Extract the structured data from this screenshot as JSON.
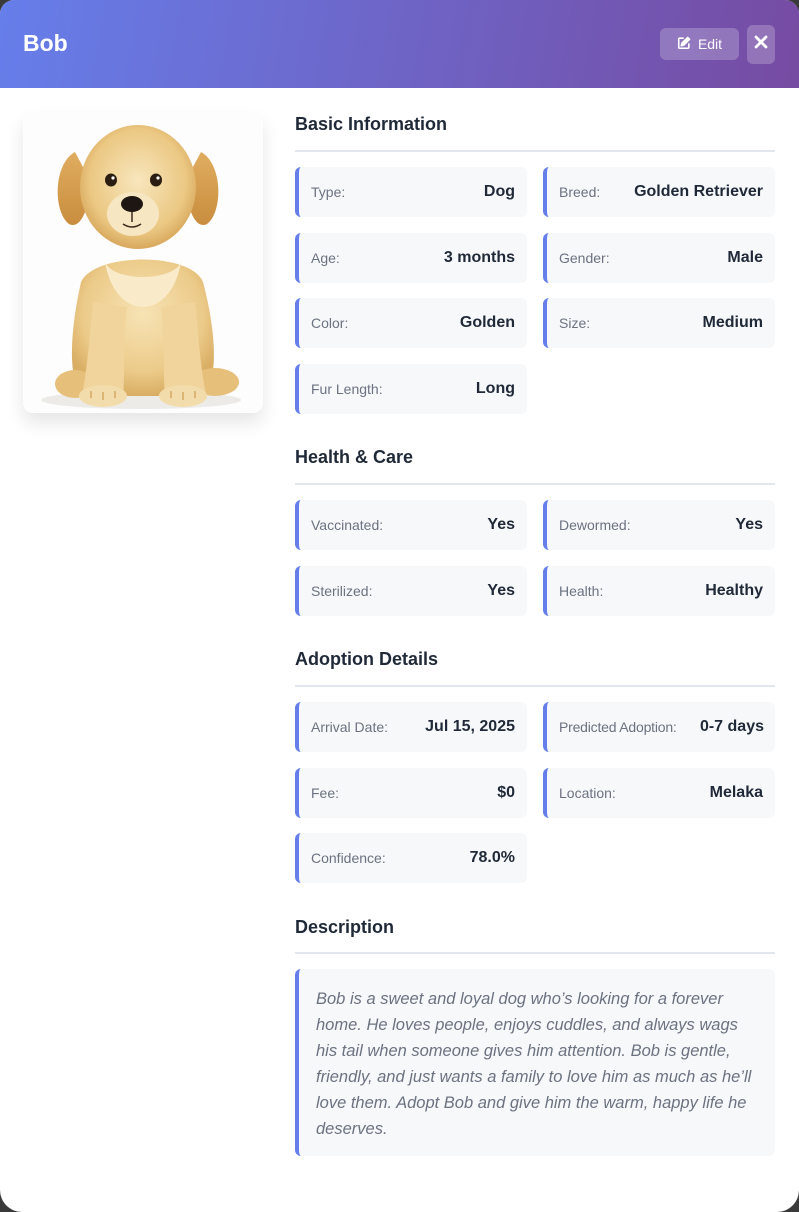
{
  "header": {
    "title": "Bob",
    "edit_label": "Edit",
    "accent_from": "#667eea",
    "accent_to": "#764ba2"
  },
  "photo": {
    "alt": "Golden retriever puppy sitting"
  },
  "sections": {
    "basic": {
      "title": "Basic Information",
      "fields": [
        {
          "label": "Type:",
          "value": "Dog"
        },
        {
          "label": "Breed:",
          "value": "Golden Retriever"
        },
        {
          "label": "Age:",
          "value": "3 months"
        },
        {
          "label": "Gender:",
          "value": "Male"
        },
        {
          "label": "Color:",
          "value": "Golden"
        },
        {
          "label": "Size:",
          "value": "Medium"
        },
        {
          "label": "Fur Length:",
          "value": "Long"
        }
      ]
    },
    "health": {
      "title": "Health & Care",
      "fields": [
        {
          "label": "Vaccinated:",
          "value": "Yes"
        },
        {
          "label": "Dewormed:",
          "value": "Yes"
        },
        {
          "label": "Sterilized:",
          "value": "Yes"
        },
        {
          "label": "Health:",
          "value": "Healthy"
        }
      ]
    },
    "adoption": {
      "title": "Adoption Details",
      "fields": [
        {
          "label": "Arrival Date:",
          "value": "Jul 15, 2025"
        },
        {
          "label": "Predicted Adoption:",
          "value": "0-7 days"
        },
        {
          "label": "Fee:",
          "value": "$0"
        },
        {
          "label": "Location:",
          "value": "Melaka"
        },
        {
          "label": "Confidence:",
          "value": "78.0%"
        }
      ]
    },
    "description": {
      "title": "Description",
      "text": "Bob is a sweet and loyal dog who’s looking for a forever home. He loves people, enjoys cuddles, and always wags his tail when someone gives him attention. Bob is gentle, friendly, and just wants a family to love him as much as he’ll love them. Adopt Bob and give him the warm, happy life he deserves."
    }
  }
}
